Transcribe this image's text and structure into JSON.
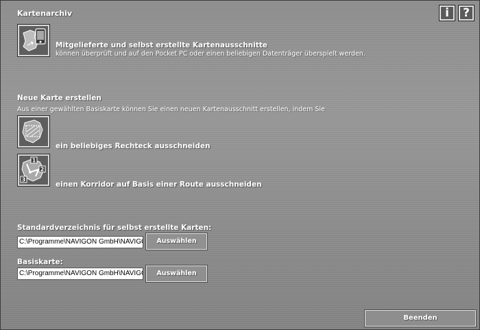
{
  "header": {
    "title": "Kartenarchiv",
    "info_button": "i",
    "help_button": "?"
  },
  "archive": {
    "headline": "Mitgelieferte und selbst erstellte Kartenausschnitte",
    "description": "können überprüft und auf den Pocket PC oder einen beliebigen Datenträger überspielt werden."
  },
  "new_map": {
    "title": "Neue Karte erstellen",
    "description": "Aus einer gewählten Basiskarte können Sie einen neuen Kartenausschnitt erstellen, indem Sie",
    "option_rectangle": "ein beliebiges Rechteck ausschneiden",
    "option_corridor": "einen Korridor auf Basis einer Route ausschneiden",
    "corridor_numbers": [
      "1",
      "2",
      "3"
    ]
  },
  "default_dir": {
    "label": "Standardverzeichnis für selbst erstellte Karten:",
    "value": "C:\\Programme\\NAVIGON GmbH\\NAVIGON",
    "button": "Auswählen"
  },
  "base_map": {
    "label": "Basiskarte:",
    "value": "C:\\Programme\\NAVIGON GmbH\\NAVIGON",
    "button": "Auswählen"
  },
  "footer": {
    "exit_button": "Beenden"
  }
}
